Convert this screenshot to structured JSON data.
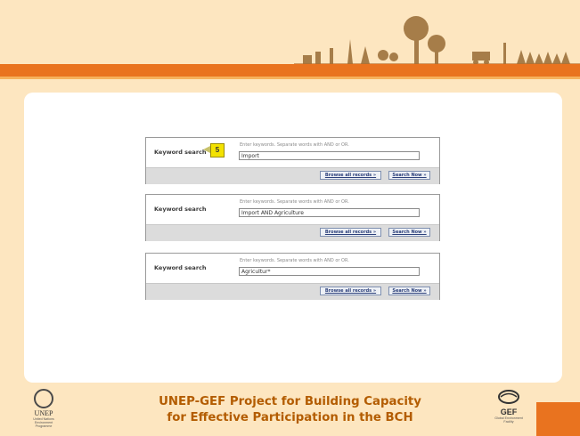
{
  "boxes": [
    {
      "label": "Keyword search",
      "hint": "Enter keywords. Separate words with AND or OR.",
      "value": "Import",
      "browse_label": "Browse all records »",
      "search_label": "Search Now »"
    },
    {
      "label": "Keyword search",
      "hint": "Enter keywords. Separate words with AND or OR.",
      "value": "Import AND Agriculture",
      "browse_label": "Browse all records »",
      "search_label": "Search Now »"
    },
    {
      "label": "Keyword search",
      "hint": "Enter keywords. Separate words with AND or OR.",
      "value": "Agricultur*",
      "browse_label": "Browse all records »",
      "search_label": "Search Now »"
    }
  ],
  "callout": {
    "number": "5"
  },
  "footer": {
    "title_line1": "UNEP-GEF Project for Building Capacity",
    "title_line2": "for Effective Participation in the BCH",
    "unep_logo_text": "UNEP",
    "unep_sub_line1": "United Nations",
    "unep_sub_line2": "Environment Programme",
    "gef_logo_text": "GEF",
    "gef_sub_line1": "Global Environment",
    "gef_sub_line2": "Facility"
  },
  "colors": {
    "accent": "#e9731f",
    "background": "#fde6c0",
    "title": "#b35c00"
  }
}
